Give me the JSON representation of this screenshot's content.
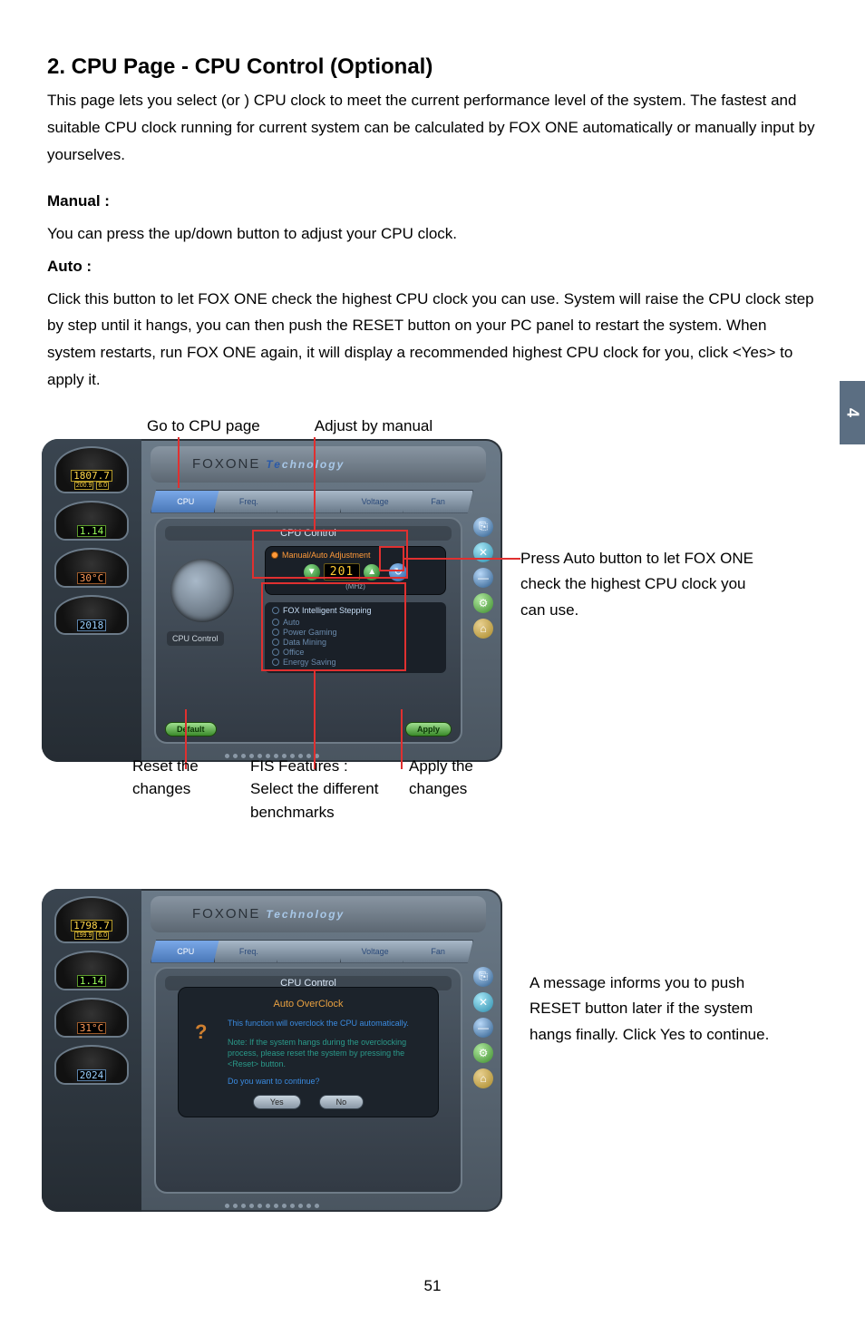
{
  "page_tab": "4",
  "page_number": "51",
  "heading": "2. CPU Page - CPU Control (Optional)",
  "intro": "This page lets you select (or  ) CPU clock to meet the current performance level of the system. The fastest and suitable CPU clock running for current system can be calculated by FOX ONE automatically or manually input by yourselves.",
  "manual_label": "Manual :",
  "manual_text": "You can press the up/down button to adjust your CPU clock.",
  "auto_label": "Auto :",
  "auto_text": "Click this button to let FOX ONE check the highest CPU clock you can use. System will raise the CPU clock step by step until it hangs, you can then push the RESET button on your PC panel to restart the system. When system restarts, run FOX ONE again, it will display a recommended highest CPU clock for you, click <Yes> to apply it.",
  "callouts": {
    "top1": "Go to CPU page",
    "top2": "Adjust by manual",
    "side1": "Press Auto button to let FOX ONE check the highest CPU clock you can use.",
    "bottom1": "Reset the changes",
    "bottom2": "FIS Features : Select the different benchmarks",
    "bottom3": "Apply the changes",
    "side2": "A message informs you to push RESET button later if the system hangs finally. Click Yes to continue."
  },
  "app1": {
    "title_brand": "FOXONE",
    "title_tech_t": "Te",
    "title_tech_rest": "chnology",
    "tabs": [
      "CPU",
      "Freq.",
      "",
      "Voltage",
      "Fan"
    ],
    "panel_header": "CPU Control",
    "cpu_label": "CPU Control",
    "manual_label": "Manual/Auto Adjustment",
    "freq_value": "201",
    "mhz": "(MHz)",
    "fis_header": "FOX Intelligent Stepping",
    "fis_options": [
      "Auto",
      "Power Gaming",
      "Data Mining",
      "Office",
      "Energy Saving"
    ],
    "btn_default": "Default",
    "btn_apply": "Apply",
    "gauges": {
      "main": "1807.7",
      "main_sub1": "200.9",
      "main_sub2": "6.0",
      "volt": "1.14",
      "temp": "30°C",
      "fan": "2018"
    }
  },
  "app2": {
    "title_brand": "FOXONE",
    "title_tech": "Technology",
    "tabs": [
      "CPU",
      "Freq.",
      "",
      "Voltage",
      "Fan"
    ],
    "panel_header": "CPU Control",
    "dialog_title": "Auto OverClock",
    "dialog_msg": "This function will overclock the CPU automatically.",
    "dialog_note": "Note: If the system hangs during the overclocking process, please reset the system by pressing the <Reset> button.",
    "dialog_q": "Do you want to continue?",
    "btn_yes": "Yes",
    "btn_no": "No",
    "gauges": {
      "main": "1798.7",
      "main_sub1": "199.9",
      "main_sub2": "6.0",
      "volt": "1.14",
      "temp": "31°C",
      "fan": "2024"
    }
  }
}
